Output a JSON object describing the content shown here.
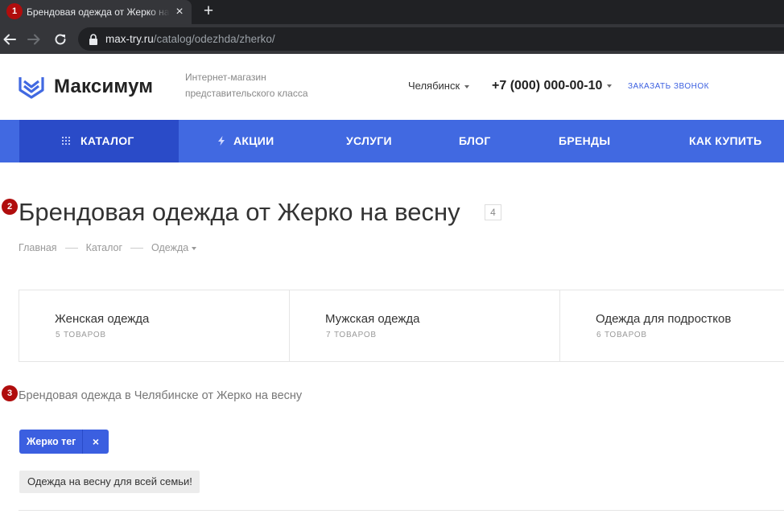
{
  "browser": {
    "tab_title": "Брендовая одежда от Жерко на весну",
    "tab_close": "×",
    "new_tab": "+",
    "url_host": "max-try.ru",
    "url_path": "/catalog/odezhda/zherko/"
  },
  "markers": [
    "1",
    "2",
    "3"
  ],
  "header": {
    "logo_text": "Максимум",
    "tagline": "Интернет-магазин представительского класса",
    "city": "Челябинск",
    "phone": "+7 (000) 000-00-10",
    "callback": "ЗАКАЗАТЬ ЗВОНОК"
  },
  "nav": {
    "catalog": "КАТАЛОГ",
    "promos": "АКЦИИ",
    "services": "УСЛУГИ",
    "blog": "БЛОГ",
    "brands": "БРЕНДЫ",
    "how_to_buy": "КАК КУПИТЬ"
  },
  "page": {
    "title": "Брендовая одежда от Жерко на весну",
    "count": "4",
    "breadcrumb": [
      "Главная",
      "Каталог",
      "Одежда"
    ],
    "categories": [
      {
        "name": "Женская одежда",
        "count": "5 ТОВАРОВ"
      },
      {
        "name": "Мужская одежда",
        "count": "7 ТОВАРОВ"
      },
      {
        "name": "Одежда для подростков",
        "count": "6 ТОВАРОВ"
      }
    ],
    "seo_title": "Брендовая одежда в Челябинске от Жерко на весну",
    "tag_label": "Жерко тег",
    "tag_close": "×",
    "chip": "Одежда на весну для всей семьи!"
  },
  "colors": {
    "accent": "#4169e1",
    "accent_dark": "#2a4bc8",
    "marker": "#b00d0d"
  }
}
